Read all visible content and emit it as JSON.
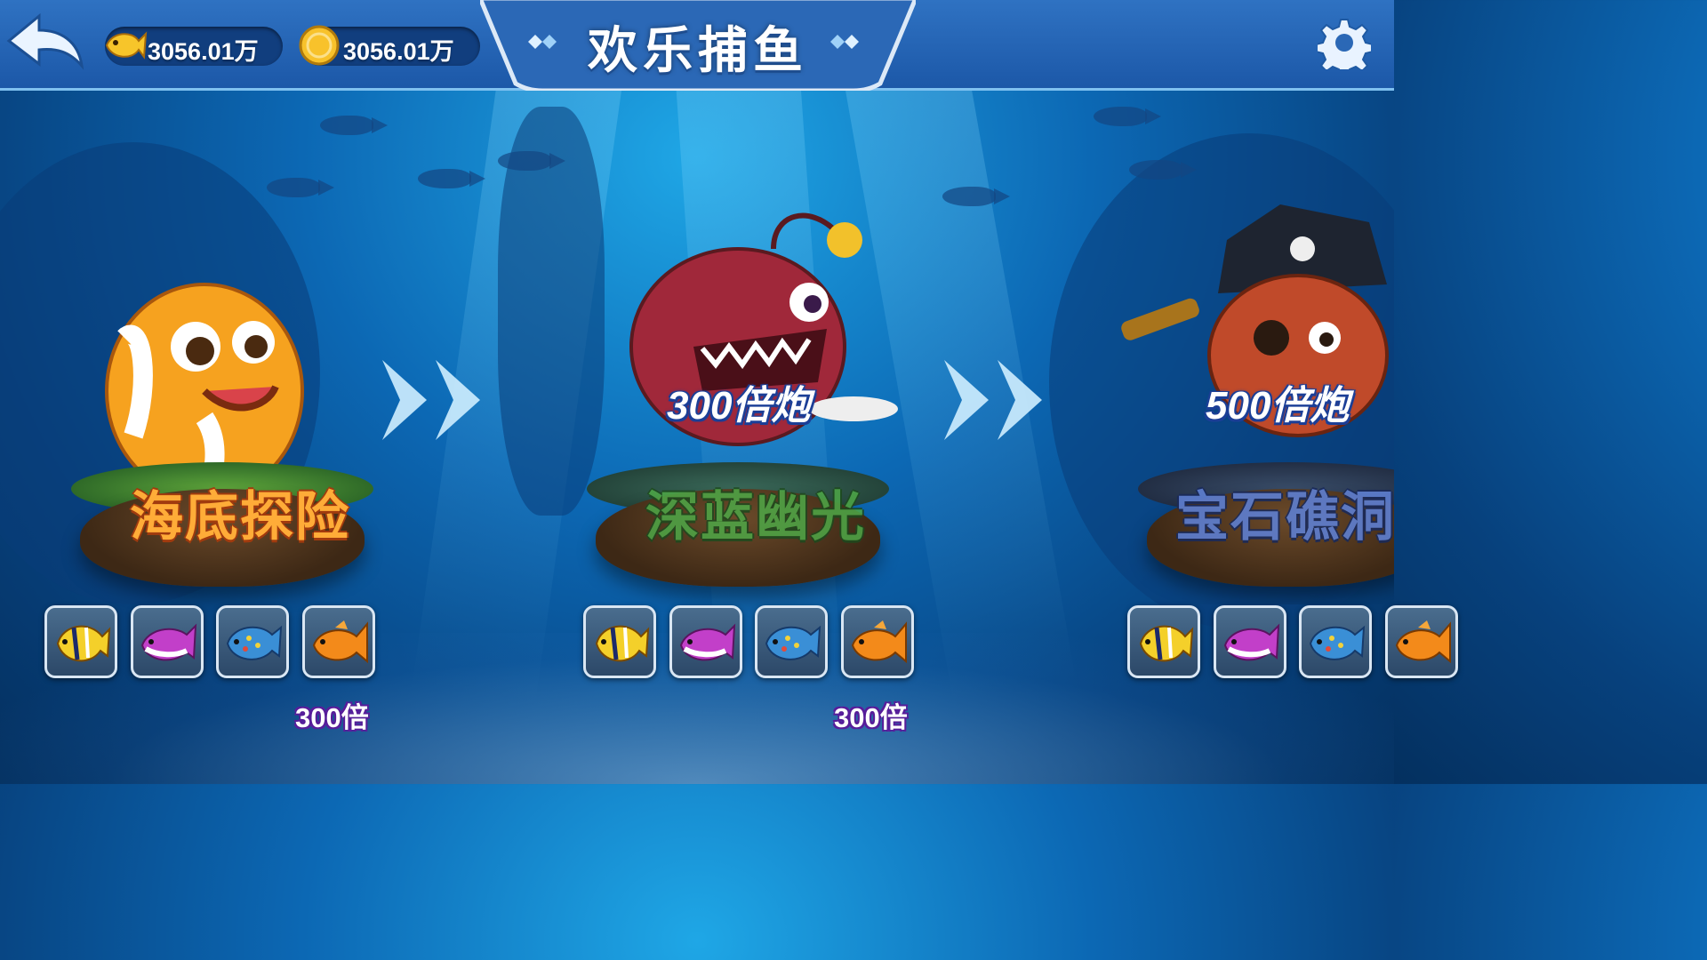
{
  "header": {
    "title": "欢乐捕鱼",
    "fish_currency": "3056.01万",
    "gold_currency": "3056.01万"
  },
  "stages": [
    {
      "name": "海底探险",
      "mascot": "clownfish",
      "unlock_multiplier": "",
      "name_color": "#ff9a2e",
      "fish_multiplier": "300倍",
      "fish": [
        "butterfly-fish-icon",
        "purple-fish-icon",
        "blue-spotted-fish-icon",
        "orange-goldfish-icon"
      ]
    },
    {
      "name": "深蓝幽光",
      "mascot": "anglerfish",
      "unlock_multiplier": "300倍炮",
      "name_color": "#4fa84a",
      "fish_multiplier": "300倍",
      "fish": [
        "butterfly-fish-icon",
        "purple-fish-icon",
        "blue-spotted-fish-icon",
        "orange-goldfish-icon"
      ]
    },
    {
      "name": "宝石礁洞",
      "mascot": "pirate-octopus",
      "unlock_multiplier": "500倍炮",
      "name_color": "#5a7bd0",
      "fish_multiplier": "",
      "fish": [
        "butterfly-fish-icon",
        "purple-fish-icon",
        "blue-spotted-fish-icon",
        "orange-goldfish-icon"
      ]
    }
  ],
  "colors": {
    "header_bg": "#2563b4",
    "title_plate": "#dce9f7",
    "multiplier_outline": "#5a1e9e",
    "mult_cannon_outline": "#1c3f97"
  }
}
